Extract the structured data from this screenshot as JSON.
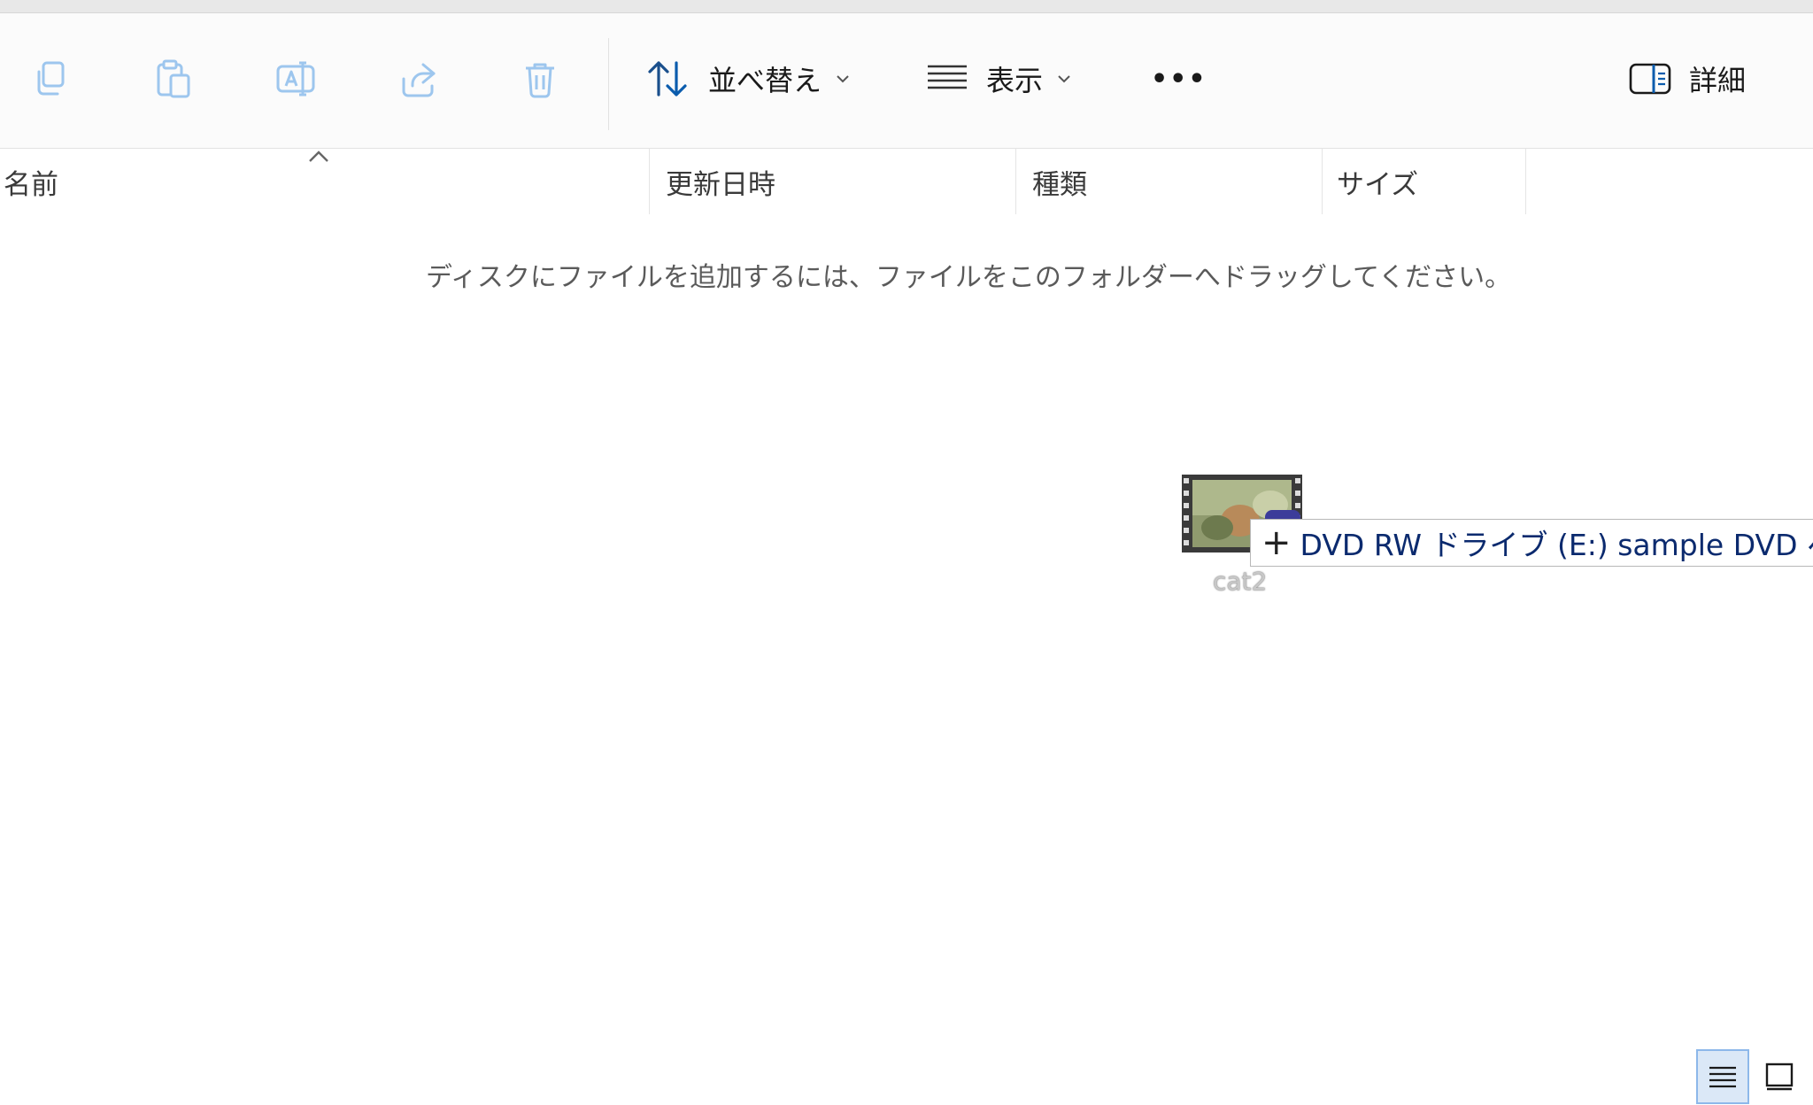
{
  "toolbar": {
    "copy_icon": "copy-icon",
    "paste_icon": "paste-icon",
    "rename_icon": "rename-icon",
    "share_icon": "share-icon",
    "delete_icon": "delete-icon",
    "sort_label": "並べ替え",
    "view_label": "表示",
    "more_label": "•••",
    "details_label": "詳細"
  },
  "columns": {
    "name": "名前",
    "modified": "更新日時",
    "type": "種類",
    "size": "サイズ"
  },
  "empty_message": "ディスクにファイルを追加するには、ファイルをこのフォルダーへドラッグしてください。",
  "drag": {
    "file_name": "cat2",
    "tooltip": "DVD RW ドライブ (E:) sample DVD へコピ"
  },
  "colors": {
    "disabled_icon": "#9dc6ee",
    "accent": "#0b5cad",
    "tooltip_text": "#0b2a6e"
  }
}
